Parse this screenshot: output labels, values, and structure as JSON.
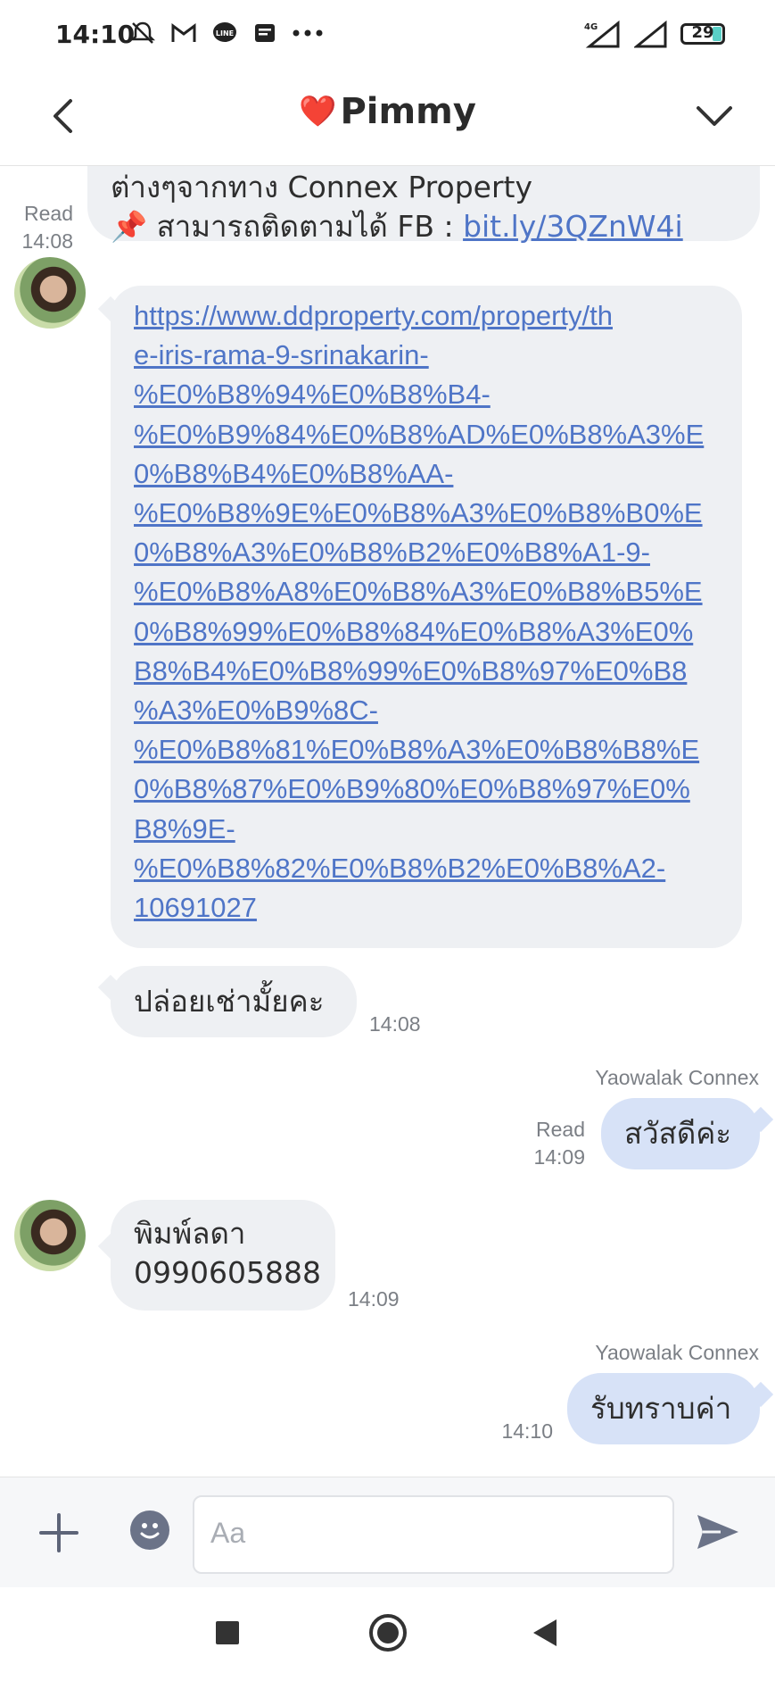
{
  "status_bar": {
    "time": "14:10",
    "network": "4G",
    "battery": "29"
  },
  "header": {
    "title": "Pimmy",
    "title_emoji": "❤️"
  },
  "messages": {
    "m1": {
      "line1": "ต่างๆจากทาง Connex Property",
      "pin": "📌",
      "line2_text": " สามารถติดตามได้ FB : ",
      "line2_link": "bit.ly/3QZnW4i",
      "read": "Read",
      "time": "14:08"
    },
    "m2": {
      "url_lines": [
        "https://www.ddproperty.com/property/th",
        "e-iris-rama-9-srinakarin-",
        "%E0%B8%94%E0%B8%B4-",
        "%E0%B9%84%E0%B8%AD%E0%B8%A3%E",
        "0%B8%B4%E0%B8%AA-",
        "%E0%B8%9E%E0%B8%A3%E0%B8%B0%E",
        "0%B8%A3%E0%B8%B2%E0%B8%A1-9-",
        "%E0%B8%A8%E0%B8%A3%E0%B8%B5%E",
        "0%B8%99%E0%B8%84%E0%B8%A3%E0%",
        "B8%B4%E0%B8%99%E0%B8%97%E0%B8",
        "%A3%E0%B9%8C-",
        "%E0%B8%81%E0%B8%A3%E0%B8%B8%E",
        "0%B8%87%E0%B9%80%E0%B8%97%E0%",
        "B8%9E-",
        "%E0%B8%82%E0%B8%B2%E0%B8%A2-",
        "10691027"
      ]
    },
    "m3": {
      "text": "ปล่อยเช่ามั้ยคะ",
      "time": "14:08"
    },
    "m4": {
      "sender": "Yaowalak Connex",
      "text": "สวัสดีค่ะ",
      "read": "Read",
      "time": "14:09"
    },
    "m5": {
      "line1": "พิมพ์ลดา",
      "line2": "0990605888",
      "time": "14:09"
    },
    "m6": {
      "sender": "Yaowalak Connex",
      "text": "รับทราบค่า",
      "time": "14:10"
    }
  },
  "input": {
    "placeholder": "Aa"
  },
  "icons": {
    "back": "chevron-left-icon",
    "menu": "chevron-down-icon",
    "plus": "plus-icon",
    "emoji": "smiley-icon",
    "send": "send-icon"
  },
  "colors": {
    "incoming_bubble": "#eef0f3",
    "outgoing_bubble": "#d7e2f7",
    "link": "#4f75c7"
  }
}
